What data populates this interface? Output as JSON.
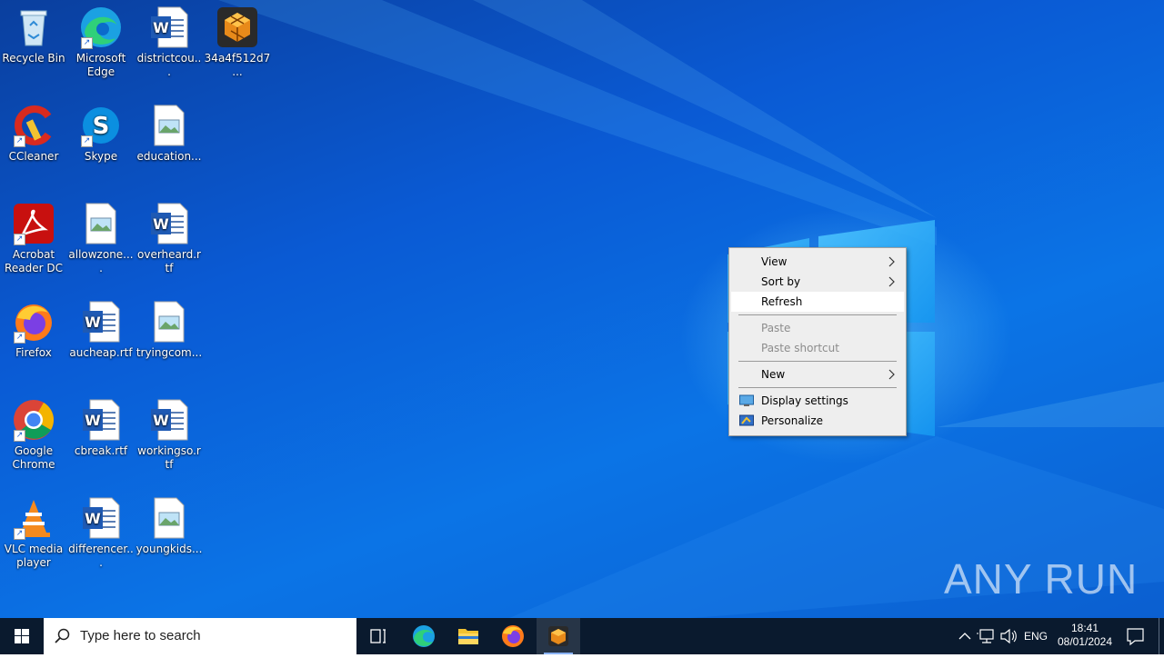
{
  "desktop_icons": [
    {
      "label": "Recycle Bin"
    },
    {
      "label": "Microsoft Edge"
    },
    {
      "label": "districtcou..."
    },
    {
      "label": "34a4f512d7..."
    },
    {
      "label": "CCleaner"
    },
    {
      "label": "Skype"
    },
    {
      "label": "education..."
    },
    {
      "label": "Acrobat Reader DC"
    },
    {
      "label": "allowzone...."
    },
    {
      "label": "overheard.rtf"
    },
    {
      "label": "Firefox"
    },
    {
      "label": "aucheap.rtf"
    },
    {
      "label": "tryingcom..."
    },
    {
      "label": "Google Chrome"
    },
    {
      "label": "cbreak.rtf"
    },
    {
      "label": "workingso.rtf"
    },
    {
      "label": "VLC media player"
    },
    {
      "label": "differencer..."
    },
    {
      "label": "youngkids..."
    }
  ],
  "context_menu": {
    "view": "View",
    "sort_by": "Sort by",
    "refresh": "Refresh",
    "paste": "Paste",
    "paste_shortcut": "Paste shortcut",
    "new": "New",
    "display_settings": "Display settings",
    "personalize": "Personalize"
  },
  "taskbar": {
    "search_placeholder": "Type here to search",
    "language": "ENG",
    "time": "18:41",
    "date": "08/01/2024"
  },
  "watermark": "ANY RUN",
  "colors": {
    "desktop_blue": "#0b74e6",
    "taskbar": "#0a1a2e",
    "menu_bg": "#eeeeee"
  }
}
